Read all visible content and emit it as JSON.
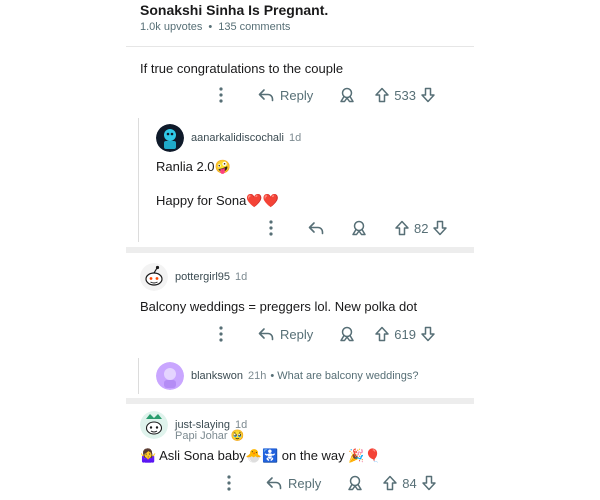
{
  "post": {
    "title": "Sonakshi Sinha Is Pregnant.",
    "upvotes": "1.0k upvotes",
    "comments": "135 comments"
  },
  "comments": [
    {
      "text": "If true congratulations to the couple",
      "reply_label": "Reply",
      "votes": "533"
    },
    {
      "user": "aanarkalidiscochali",
      "age": "1d",
      "line1": "Ranlia 2.0🤪",
      "line2": "Happy for Sona❤️❤️",
      "votes": "82",
      "avatar_color": "#0f1a2a"
    },
    {
      "user": "pottergirl95",
      "age": "1d",
      "text": "Balcony weddings = preggers lol. New polka dot",
      "reply_label": "Reply",
      "votes": "619"
    },
    {
      "user": "blankswon",
      "age": "21h",
      "preview": "• What are balcony weddings?",
      "avatar_color": "#c9a6ff"
    },
    {
      "user": "just-slaying",
      "age": "1d",
      "flair": "Papi Johar 🥹",
      "text": "🤷‍♀️ Asli Sona baby🐣🚼 on the way 🎉🎈",
      "reply_label": "Reply",
      "votes": "84"
    }
  ],
  "colors": {
    "meta": "#576f76",
    "separator": "#ededed",
    "thread_line": "#dcdcdc"
  }
}
